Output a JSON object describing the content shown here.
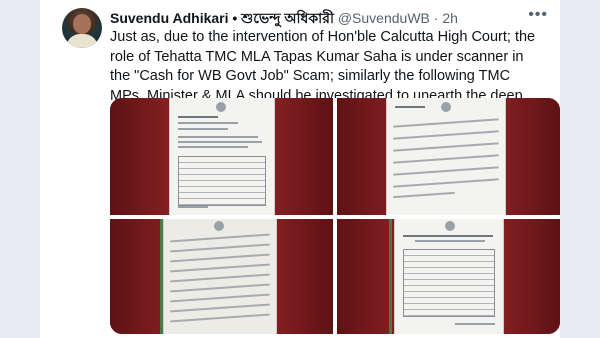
{
  "tweet": {
    "author_name": "Suvendu Adhikari • শুভেন্দু অধিকারী",
    "handle": "@SuvenduWB",
    "separator": "·",
    "time": "2h",
    "more_icon": "more-horizontal-icon",
    "text": "Just as, due to the intervention of Hon'ble Calcutta High Court; the role of Tehatta TMC MLA Tapas Kumar Saha is under scanner in the \"Cash for WB Govt Job\" Scam; similarly the following TMC MPs, Minister & MLA should be investigated to unearth the deep roots of the racket:-"
  },
  "media": {
    "count": 4,
    "colors": {
      "background": "#7a1b1c",
      "paper": "#f3f3ef"
    }
  }
}
